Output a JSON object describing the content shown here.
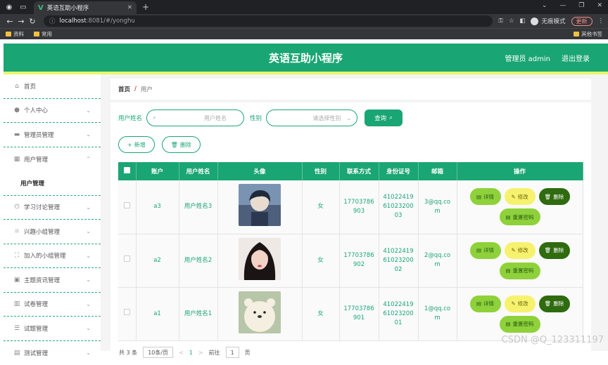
{
  "browser": {
    "tab_title": "英语互助小程序",
    "url_host": "localhost",
    "url_rest": ":8081/#/yonghu",
    "incognito_label": "无痕模式",
    "update_label": "更新",
    "bookmarks": [
      "资料",
      "常用"
    ],
    "other_bookmarks": "其他书签"
  },
  "header": {
    "title": "英语互助小程序",
    "user": "管理员 admin",
    "logout": "退出登录"
  },
  "sidebar": {
    "items": [
      {
        "label": "首页",
        "icon": "home-icon"
      },
      {
        "label": "个人中心",
        "icon": "user-icon"
      },
      {
        "label": "管理员管理",
        "icon": "admin-icon"
      },
      {
        "label": "用户管理",
        "icon": "grid-icon"
      },
      {
        "label": "用户管理",
        "icon": ""
      },
      {
        "label": "学习讨论管理",
        "icon": "power-icon"
      },
      {
        "label": "兴趣小组管理",
        "icon": "crop-icon"
      },
      {
        "label": "加入的小组管理",
        "icon": "fullscreen-icon"
      },
      {
        "label": "主题资讯管理",
        "icon": "doc-icon"
      },
      {
        "label": "试卷管理",
        "icon": "bars-icon"
      },
      {
        "label": "试题管理",
        "icon": "sliders-icon"
      },
      {
        "label": "测试管理",
        "icon": "test-icon"
      }
    ]
  },
  "breadcrumb": {
    "home": "首页",
    "sep": "/",
    "current": "用户"
  },
  "search": {
    "name_label": "用户姓名",
    "name_placeholder": "用户姓名",
    "gender_label": "性别",
    "gender_placeholder": "请选择性别",
    "query_label": "查询"
  },
  "actions": {
    "add_label": "新增",
    "delete_label": "删除"
  },
  "table": {
    "headers": [
      "",
      "账户",
      "用户姓名",
      "头像",
      "性别",
      "联系方式",
      "身份证号",
      "邮箱",
      "操作"
    ],
    "rows": [
      {
        "account": "a3",
        "name": "用户姓名3",
        "gender": "女",
        "phone": "17703786903",
        "id": "410224196102320003",
        "email": "3@qq.com",
        "avatar_color": "#6f84a3"
      },
      {
        "account": "a2",
        "name": "用户姓名2",
        "gender": "女",
        "phone": "17703786902",
        "id": "410224196102320002",
        "email": "2@qq.com",
        "avatar_color": "#3a3030"
      },
      {
        "account": "a1",
        "name": "用户姓名1",
        "gender": "女",
        "phone": "17703786901",
        "id": "410224196102320001",
        "email": "1@qq.com",
        "avatar_color": "#d8d4c0"
      }
    ],
    "op_labels": {
      "detail": "详情",
      "edit": "修改",
      "delete": "删除",
      "reset": "重置密码"
    }
  },
  "pager": {
    "total": "共 3 条",
    "page_size": "10条/页",
    "prev": "<",
    "page": "1",
    "next": ">",
    "goto": "前往",
    "goto_page": "1",
    "suffix": "页"
  },
  "watermark": "CSDN @Q_123311197",
  "colors": {
    "primary": "#1aa574",
    "accent_yellow": "#e8f76a",
    "detail_btn": "#8fd13a",
    "edit_btn": "#f7f26e",
    "delete_btn": "#2f6b0f"
  }
}
